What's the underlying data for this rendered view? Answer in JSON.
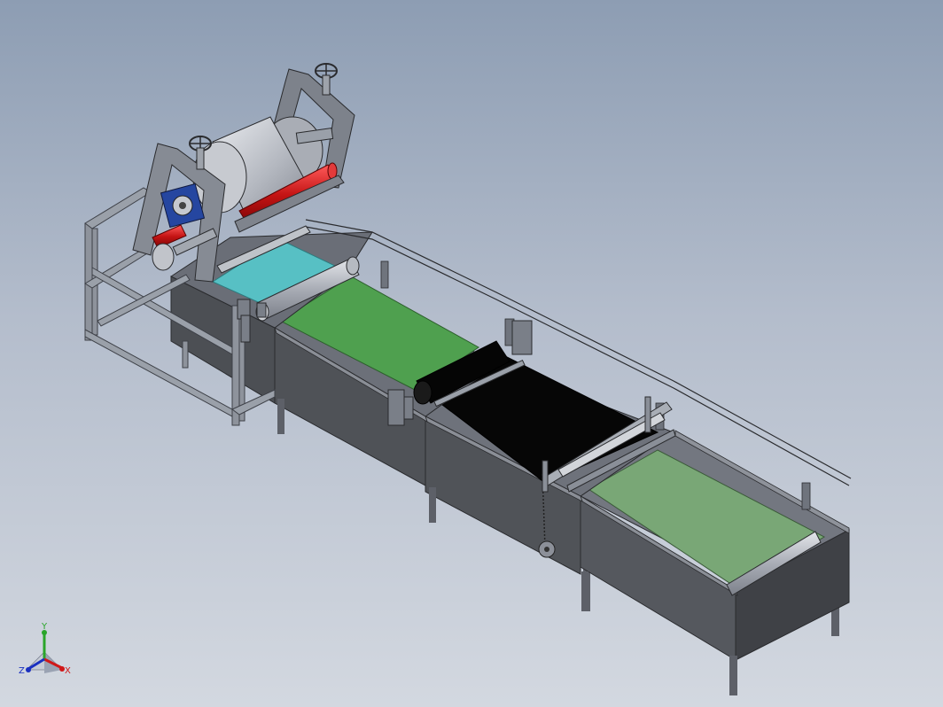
{
  "viewport": {
    "colors": {
      "belt_teal": "#57c0c4",
      "belt_green": "#4fa04f",
      "belt_black": "#060606",
      "belt_pale_green": "#79a776",
      "roller_red": "#c41414",
      "frame_steel": "#6f747d",
      "tank_wall": "#4f5156",
      "motor_blue": "#2546a0"
    }
  },
  "triad": {
    "y_label": "Y",
    "x_label": "X",
    "z_label": "Z",
    "y_color": "#2aa52a",
    "x_color": "#d01818",
    "z_color": "#1a30c0"
  }
}
